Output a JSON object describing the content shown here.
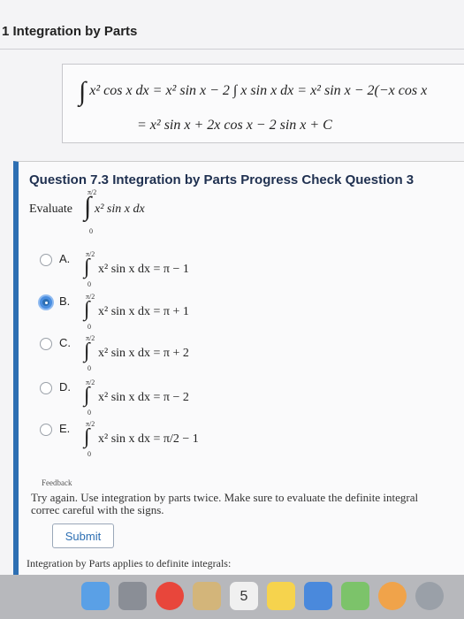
{
  "section": {
    "title": "1 Integration by Parts"
  },
  "example": {
    "line1": "x² cos x dx = x² sin x − 2 ∫ x sin x dx = x² sin x − 2(−x cos x",
    "line2": "= x² sin x + 2x cos x − 2 sin x + C"
  },
  "question": {
    "title": "Question 7.3 Integration by Parts Progress Check Question 3",
    "evaluate_label": "Evaluate",
    "integral": "x² sin x dx",
    "upper_limit": "π/2",
    "lower_limit": "0"
  },
  "options": [
    {
      "letter": "A.",
      "frac": "π/2",
      "expr": "x² sin x dx = π − 1",
      "selected": false
    },
    {
      "letter": "B.",
      "frac": "π/2",
      "expr": "x² sin x dx = π + 1",
      "selected": true
    },
    {
      "letter": "C.",
      "frac": "π/2",
      "expr": "x² sin x dx = π + 2",
      "selected": false
    },
    {
      "letter": "D.",
      "frac": "π/2",
      "expr": "x² sin x dx = π − 2",
      "selected": false
    },
    {
      "letter": "E.",
      "frac": "π/2",
      "expr": "x² sin x dx = π/2 − 1",
      "selected": false
    }
  ],
  "feedback": {
    "label": "Feedback",
    "text": "Try again. Use integration by parts twice. Make sure to evaluate the definite integral correc careful with the signs."
  },
  "submit_label": "Submit",
  "bottom_text": "Integration by Parts applies to definite integrals:",
  "dock": {
    "icons": [
      "finder-icon",
      "rocket-icon",
      "chrome-icon",
      "preview-icon",
      "app-icon",
      "calendar-icon",
      "notes-icon",
      "music-icon",
      "photos-icon",
      "settings-icon"
    ],
    "calendar_day": "5"
  }
}
